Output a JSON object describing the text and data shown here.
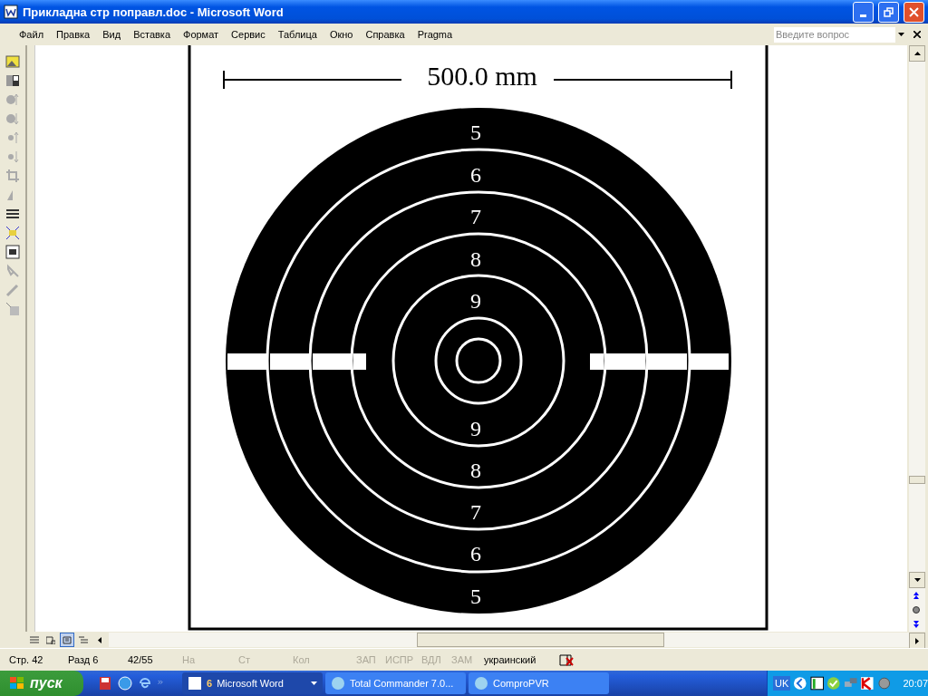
{
  "window": {
    "title": "Прикладна стр поправл.doc - Microsoft Word"
  },
  "menu": [
    {
      "label": "Файл"
    },
    {
      "label": "Правка"
    },
    {
      "label": "Вид"
    },
    {
      "label": "Вставка"
    },
    {
      "label": "Формат"
    },
    {
      "label": "Сервис"
    },
    {
      "label": "Таблица"
    },
    {
      "label": "Окно"
    },
    {
      "label": "Справка"
    },
    {
      "label": "Pragma"
    }
  ],
  "help_search": {
    "placeholder": "Введите вопрос"
  },
  "document": {
    "figure": {
      "scale_label": "500.0 mm",
      "upper_numbers": [
        "5",
        "6",
        "7",
        "8",
        "9"
      ],
      "lower_numbers": [
        "9",
        "8",
        "7",
        "6",
        "5"
      ]
    }
  },
  "view_buttons": [
    {
      "selected": false
    },
    {
      "selected": false
    },
    {
      "selected": true
    },
    {
      "selected": false
    }
  ],
  "status_bar": [
    {
      "text": "Стр. 42",
      "disabled": false
    },
    {
      "text": "Разд 6",
      "disabled": false
    },
    {
      "text": "42/55",
      "disabled": false
    },
    {
      "text": "На",
      "disabled": true
    },
    {
      "text": "Ст",
      "disabled": true
    },
    {
      "text": "Кол",
      "disabled": true
    },
    {
      "text": "ЗАП",
      "disabled": true
    },
    {
      "text": "ИСПР",
      "disabled": true
    },
    {
      "text": "ВДЛ",
      "disabled": true
    },
    {
      "text": "ЗАМ",
      "disabled": true
    },
    {
      "text": "украинский",
      "disabled": false
    }
  ],
  "taskbar": {
    "start": "пуск",
    "tasks": [
      {
        "count": "6",
        "label": "Microsoft Word",
        "selected": true
      },
      {
        "label": "Total Commander 7.0...",
        "selected": false
      },
      {
        "label": "ComproPVR",
        "selected": false
      }
    ],
    "language": "UK",
    "clock": "20:07"
  }
}
